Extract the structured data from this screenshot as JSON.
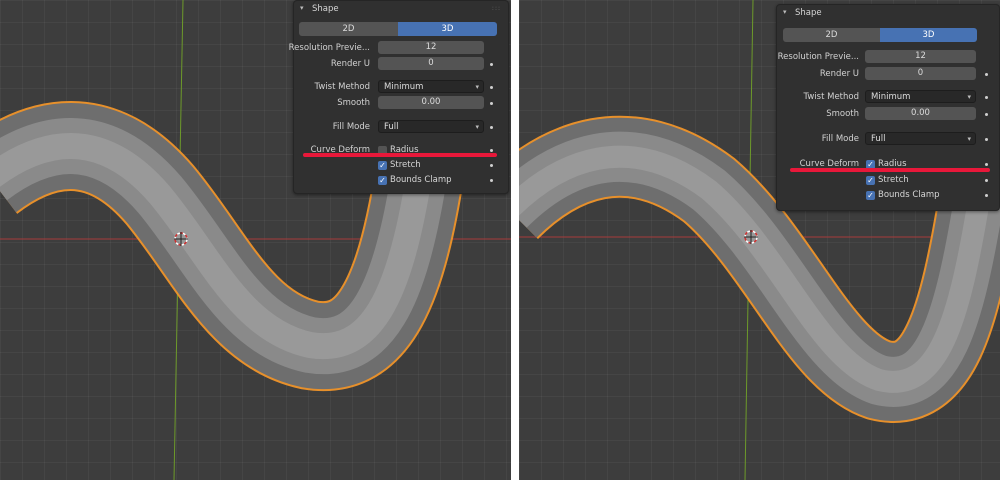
{
  "colors": {
    "viewport_bg": "#3d3d3d",
    "panel_bg": "#303030",
    "field_bg": "#545454",
    "accent_blue": "#4772b3",
    "selection_orange": "#f0952a",
    "highlight_red": "#e8183a",
    "axis_red": "#a63a3a",
    "axis_green": "#6d9a2a"
  },
  "before": {
    "panel": {
      "title": "Shape",
      "collapse_icon": "chevron-down-icon",
      "modes": [
        "2D",
        "3D"
      ],
      "active_mode": "3D",
      "resolution_preview": {
        "label": "Resolution Previe...",
        "value": "12"
      },
      "render_u": {
        "label": "Render U",
        "value": "0"
      },
      "twist_method": {
        "label": "Twist Method",
        "value": "Minimum"
      },
      "smooth": {
        "label": "Smooth",
        "value": "0.00"
      },
      "fill_mode": {
        "label": "Fill Mode",
        "value": "Full"
      },
      "curve_deform": {
        "label": "Curve Deform",
        "radius": {
          "label": "Radius",
          "checked": false
        },
        "stretch": {
          "label": "Stretch",
          "checked": true
        },
        "bounds_clamp": {
          "label": "Bounds Clamp",
          "checked": true
        }
      }
    }
  },
  "after": {
    "panel": {
      "title": "Shape",
      "collapse_icon": "chevron-down-icon",
      "modes": [
        "2D",
        "3D"
      ],
      "active_mode": "3D",
      "resolution_preview": {
        "label": "Resolution Previe...",
        "value": "12"
      },
      "render_u": {
        "label": "Render U",
        "value": "0"
      },
      "twist_method": {
        "label": "Twist Method",
        "value": "Minimum"
      },
      "smooth": {
        "label": "Smooth",
        "value": "0.00"
      },
      "fill_mode": {
        "label": "Fill Mode",
        "value": "Full"
      },
      "curve_deform": {
        "label": "Curve Deform",
        "radius": {
          "label": "Radius",
          "checked": true
        },
        "stretch": {
          "label": "Stretch",
          "checked": true
        },
        "bounds_clamp": {
          "label": "Bounds Clamp",
          "checked": true
        }
      }
    }
  },
  "icons": {
    "checkmark": "✓",
    "dropdown_arrow": "⌄",
    "collapse": "▾",
    "grip": "∷"
  }
}
